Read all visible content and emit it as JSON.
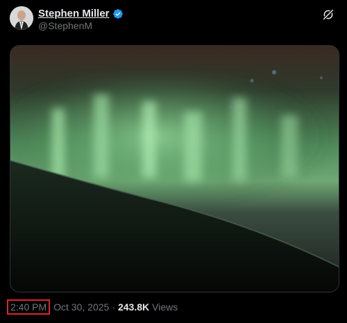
{
  "author": {
    "name": "Stephen Miller",
    "handle": "@StephenM",
    "verified_color": "#1d9bf0"
  },
  "icons": {
    "avatar": "avatar",
    "verified": "verified-badge-icon",
    "grok": "grok-icon"
  },
  "post": {
    "time": "2:40 PM",
    "date": "Oct 30, 2025",
    "separator": "·",
    "views_count": "243.8K",
    "views_label": "Views"
  },
  "colors": {
    "highlight_box": "#e0242b",
    "background": "#000000",
    "aurora_green": "#7fd48a"
  }
}
